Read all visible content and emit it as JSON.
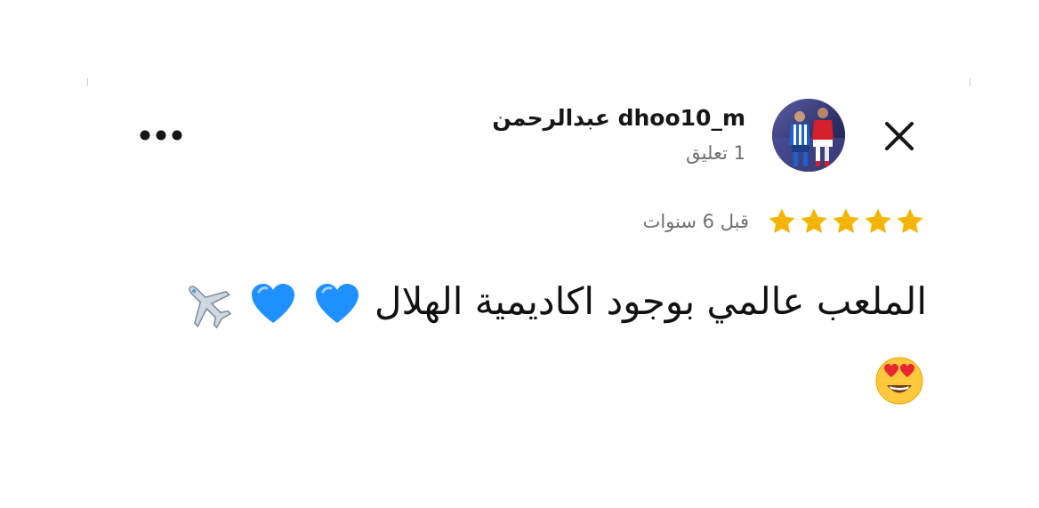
{
  "header": {
    "username": "dhoo10_m عبدالرحمن",
    "comment_count": "1 تعليق"
  },
  "review": {
    "rating": 5,
    "rating_max": 5,
    "time_ago": "قبل 6 سنوات",
    "comment_text": "الملعب عالمي بوجود اكاديمية الهلال",
    "emojis": [
      "blue-heart",
      "blue-heart",
      "airplane",
      "smiling-face-with-heart-eyes"
    ]
  },
  "colors": {
    "star": "#F5B400",
    "heart": "#1E90FF",
    "muted_text": "#707070",
    "primary_text": "#161616"
  },
  "icons": {
    "close": "close-icon",
    "more": "more-horizontal-icon",
    "star": "star-icon"
  }
}
